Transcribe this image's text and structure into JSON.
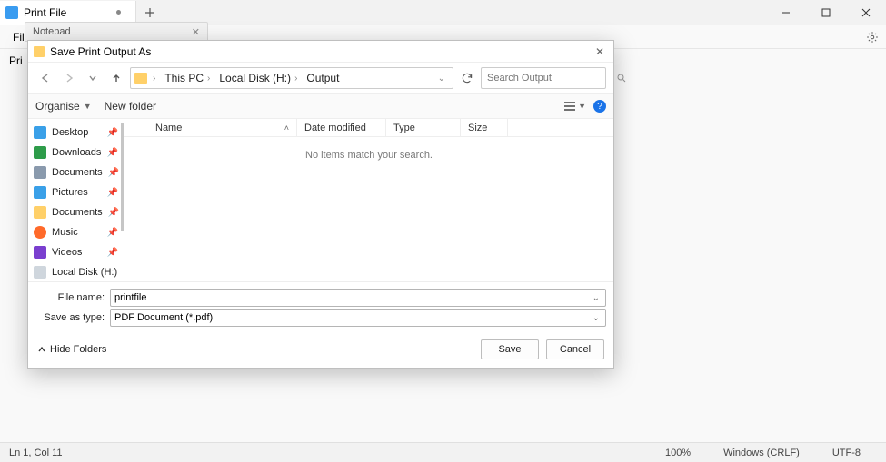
{
  "window": {
    "tab_title": "Print File",
    "modified": true,
    "menubar_visible_item": "File",
    "content_visible_text": "Pri"
  },
  "notepad_tab": {
    "title": "Notepad"
  },
  "statusbar": {
    "position": "Ln 1, Col 11",
    "zoom": "100%",
    "line_ending": "Windows (CRLF)",
    "encoding": "UTF-8"
  },
  "dialog": {
    "title": "Save Print Output As",
    "breadcrumb": [
      "This PC",
      "Local Disk (H:)",
      "Output"
    ],
    "search_placeholder": "Search Output",
    "toolbar": {
      "organise": "Organise",
      "new_folder": "New folder"
    },
    "columns": {
      "name": "Name",
      "date": "Date modified",
      "type": "Type",
      "size": "Size"
    },
    "empty_message": "No items match your search.",
    "sidebar": [
      {
        "label": "Desktop",
        "icon": "ic-desktop",
        "pinned": true
      },
      {
        "label": "Downloads",
        "icon": "ic-down",
        "pinned": true
      },
      {
        "label": "Documents",
        "icon": "ic-doc",
        "pinned": true
      },
      {
        "label": "Pictures",
        "icon": "ic-pic",
        "pinned": true
      },
      {
        "label": "Documents",
        "icon": "ic-folder",
        "pinned": true
      },
      {
        "label": "Music",
        "icon": "ic-music",
        "pinned": true
      },
      {
        "label": "Videos",
        "icon": "ic-video",
        "pinned": true
      },
      {
        "label": "Local Disk (H:)",
        "icon": "ic-disk",
        "pinned": false
      }
    ],
    "filename_label": "File name:",
    "filename_value": "printfile",
    "savetype_label": "Save as type:",
    "savetype_value": "PDF Document (*.pdf)",
    "hide_folders": "Hide Folders",
    "save": "Save",
    "cancel": "Cancel"
  }
}
